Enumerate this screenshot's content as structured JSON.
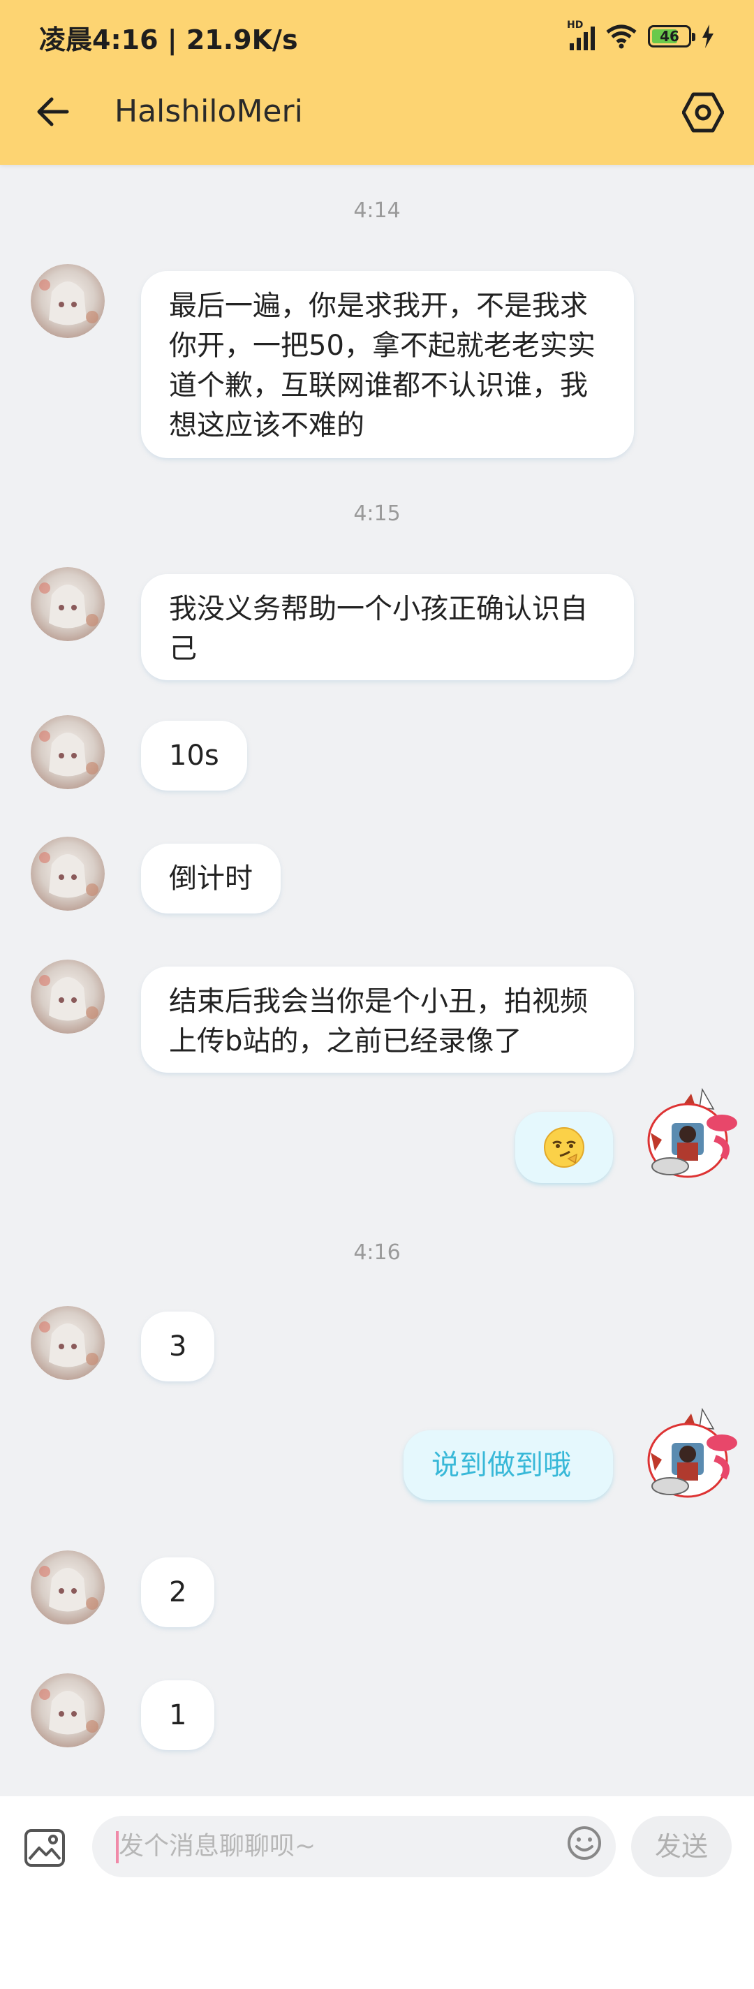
{
  "status": {
    "time_speed": "凌晨4:16 | 21.9K/s",
    "network_label": "HD",
    "battery_level": "46"
  },
  "header": {
    "title": "HalshiloMeri",
    "back_icon": "arrow-left-icon",
    "settings_icon": "hexagon-gear-icon",
    "bg_color": "#fdd472"
  },
  "messages": [
    {
      "type": "timestamp",
      "text": "4:14"
    },
    {
      "type": "msg",
      "from": "theirs",
      "text": "最后一遍，你是求我开，不是我求你开，一把50，拿不起就老老实实道个歉，互联网谁都不认识谁，我想这应该不难的"
    },
    {
      "type": "timestamp",
      "text": "4:15"
    },
    {
      "type": "msg",
      "from": "theirs",
      "text": "我没义务帮助一个小孩正确认识自己"
    },
    {
      "type": "msg",
      "from": "theirs",
      "text": "10s"
    },
    {
      "type": "msg",
      "from": "theirs",
      "text": "倒计时"
    },
    {
      "type": "msg",
      "from": "theirs",
      "text": "结束后我会当你是个小丑，拍视频上传b站的，之前已经录像了"
    },
    {
      "type": "msg",
      "from": "mine",
      "text": "",
      "emoji": "smirk-emoji"
    },
    {
      "type": "timestamp",
      "text": "4:16"
    },
    {
      "type": "msg",
      "from": "theirs",
      "text": "3"
    },
    {
      "type": "msg",
      "from": "mine",
      "text": "说到做到哦"
    },
    {
      "type": "msg",
      "from": "theirs",
      "text": "2"
    },
    {
      "type": "msg",
      "from": "theirs",
      "text": "1"
    }
  ],
  "input": {
    "placeholder": "发个消息聊聊呗~",
    "send_label": "发送"
  },
  "colors": {
    "mine_bubble": "#e5f8fd",
    "mine_text": "#38b8d8",
    "theirs_bubble": "#ffffff",
    "background": "#f0f1f3"
  }
}
